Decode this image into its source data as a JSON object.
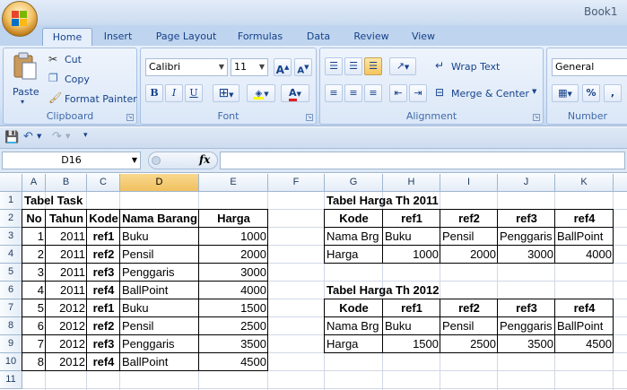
{
  "app": {
    "title": "Book1"
  },
  "tabs": [
    "Home",
    "Insert",
    "Page Layout",
    "Formulas",
    "Data",
    "Review",
    "View"
  ],
  "ribbon": {
    "clipboard": {
      "paste": "Paste",
      "cut": "Cut",
      "copy": "Copy",
      "format_painter": "Format Painter",
      "label": "Clipboard"
    },
    "font": {
      "name": "Calibri",
      "size": "11",
      "grow": "A",
      "shrink": "A",
      "bold": "B",
      "italic": "I",
      "underline": "U",
      "font_color": "A",
      "label": "Font"
    },
    "alignment": {
      "wrap_text": "Wrap Text",
      "merge_center": "Merge & Center",
      "label": "Alignment"
    },
    "number": {
      "format": "General",
      "percent": "%",
      "comma": ",",
      "label": "Number"
    }
  },
  "formula_bar": {
    "name_box": "D16",
    "fx": "fx",
    "formula": ""
  },
  "columns": [
    "A",
    "B",
    "C",
    "D",
    "E",
    "F",
    "G",
    "H",
    "I",
    "J",
    "K"
  ],
  "rows": [
    "1",
    "2",
    "3",
    "4",
    "5",
    "6",
    "7",
    "8",
    "9",
    "10",
    "11"
  ],
  "selected_cell": {
    "col": "D",
    "row": "16"
  },
  "sheet": {
    "task_title": "Tabel Task",
    "task_headers": [
      "No",
      "Tahun",
      "Kode",
      "Nama Barang",
      "Harga"
    ],
    "task_rows": [
      [
        "1",
        "2011",
        "ref1",
        "Buku",
        "1000"
      ],
      [
        "2",
        "2011",
        "ref2",
        "Pensil",
        "2000"
      ],
      [
        "3",
        "2011",
        "ref3",
        "Penggaris",
        "3000"
      ],
      [
        "4",
        "2011",
        "ref4",
        "BallPoint",
        "4000"
      ],
      [
        "5",
        "2012",
        "ref1",
        "Buku",
        "1500"
      ],
      [
        "6",
        "2012",
        "ref2",
        "Pensil",
        "2500"
      ],
      [
        "7",
        "2012",
        "ref3",
        "Penggaris",
        "3500"
      ],
      [
        "8",
        "2012",
        "ref4",
        "BallPoint",
        "4500"
      ]
    ],
    "harga_2011_title": "Tabel Harga Th 2011",
    "harga_2011": [
      [
        "Kode",
        "ref1",
        "ref2",
        "ref3",
        "ref4"
      ],
      [
        "Nama Brg",
        "Buku",
        "Pensil",
        "Penggaris",
        "BallPoint"
      ],
      [
        "Harga",
        "1000",
        "2000",
        "3000",
        "4000"
      ]
    ],
    "harga_2012_title": "Tabel Harga Th 2012",
    "harga_2012": [
      [
        "Kode",
        "ref1",
        "ref2",
        "ref3",
        "ref4"
      ],
      [
        "Nama Brg",
        "Buku",
        "Pensil",
        "Penggaris",
        "BallPoint"
      ],
      [
        "Harga",
        "1500",
        "2500",
        "3500",
        "4500"
      ]
    ]
  }
}
